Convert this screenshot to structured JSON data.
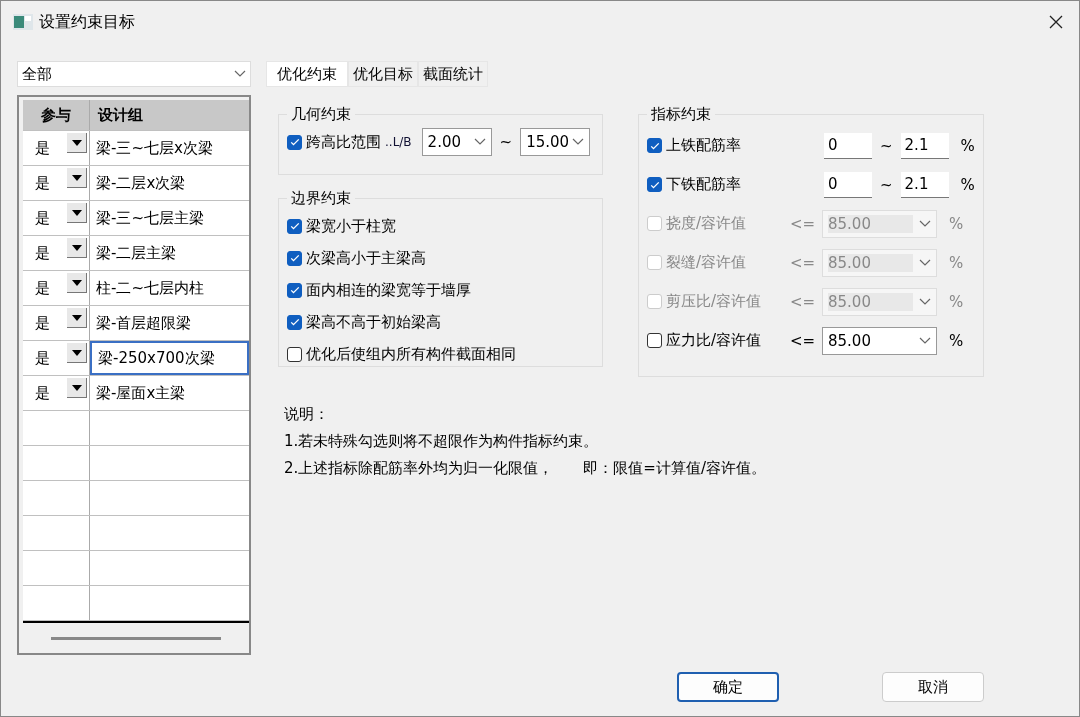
{
  "window": {
    "title": "设置约束目标"
  },
  "filter": {
    "value": "全部"
  },
  "table": {
    "columns": [
      "参与",
      "设计组"
    ],
    "rows": [
      {
        "participate": "是",
        "group": "梁-三~七层x次梁",
        "selected": false
      },
      {
        "participate": "是",
        "group": "梁-二层x次梁",
        "selected": false
      },
      {
        "participate": "是",
        "group": "梁-三~七层主梁",
        "selected": false
      },
      {
        "participate": "是",
        "group": "梁-二层主梁",
        "selected": false
      },
      {
        "participate": "是",
        "group": "柱-二~七层内柱",
        "selected": false
      },
      {
        "participate": "是",
        "group": "梁-首层超限梁",
        "selected": false
      },
      {
        "participate": "是",
        "group": "梁-250x700次梁",
        "selected": true
      },
      {
        "participate": "是",
        "group": "梁-屋面x主梁",
        "selected": false
      }
    ]
  },
  "tabs": [
    {
      "label": "优化约束",
      "selected": true
    },
    {
      "label": "优化目标",
      "selected": false
    },
    {
      "label": "截面统计",
      "selected": false
    }
  ],
  "geometry": {
    "title": "几何约束",
    "label": "跨高比范围",
    "unit": "..L/B",
    "checked": true,
    "min": "2.00",
    "tilde": "~",
    "max": "15.00"
  },
  "boundary": {
    "title": "边界约束",
    "items": [
      {
        "label": "梁宽小于柱宽",
        "checked": true
      },
      {
        "label": "次梁高小于主梁高",
        "checked": true
      },
      {
        "label": "面内相连的梁宽等于墙厚",
        "checked": true
      },
      {
        "label": "梁高不高于初始梁高",
        "checked": true
      },
      {
        "label": "优化后使组内所有构件截面相同",
        "checked": false
      }
    ]
  },
  "index": {
    "title": "指标约束",
    "rows": [
      {
        "kind": "range",
        "label": "上铁配筋率",
        "checked": true,
        "disabled": false,
        "min": "0",
        "tilde": "~",
        "max": "2.1",
        "unit": "%"
      },
      {
        "kind": "range",
        "label": "下铁配筋率",
        "checked": true,
        "disabled": false,
        "min": "0",
        "tilde": "~",
        "max": "2.1",
        "unit": "%"
      },
      {
        "kind": "limit",
        "label": "挠度/容许值",
        "checked": false,
        "disabled": true,
        "op": "<=",
        "value": "85.00",
        "unit": "%"
      },
      {
        "kind": "limit",
        "label": "裂缝/容许值",
        "checked": false,
        "disabled": true,
        "op": "<=",
        "value": "85.00",
        "unit": "%"
      },
      {
        "kind": "limit",
        "label": "剪压比/容许值",
        "checked": false,
        "disabled": true,
        "op": "<=",
        "value": "85.00",
        "unit": "%"
      },
      {
        "kind": "limit",
        "label": "应力比/容许值",
        "checked": false,
        "disabled": false,
        "op": "<=",
        "value": "85.00",
        "unit": "%"
      }
    ]
  },
  "notes": [
    "说明：",
    "1.若未特殊勾选则将不超限作为构件指标约束。",
    "2.上述指标除配筋率外均为归一化限值，　　即：限值=计算值/容许值。"
  ],
  "buttons": [
    {
      "label": "确定",
      "default": true
    },
    {
      "label": "取消",
      "default": false
    }
  ]
}
